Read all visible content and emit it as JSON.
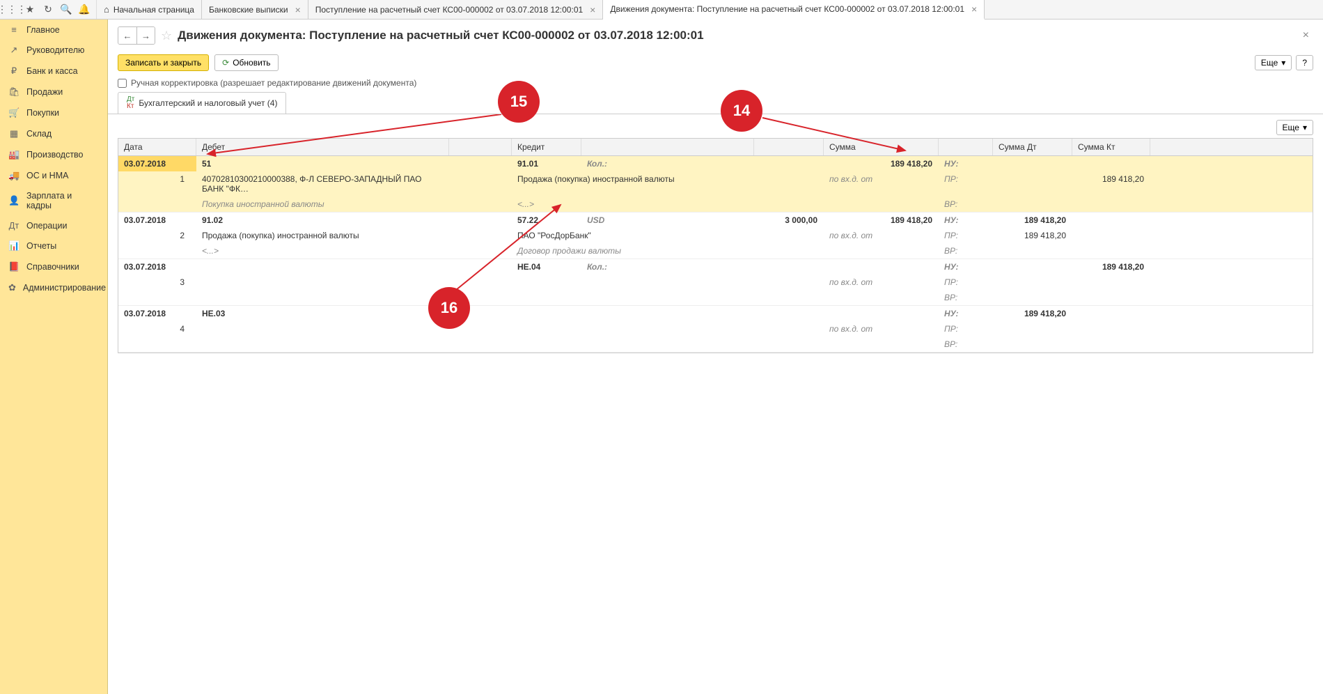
{
  "topTabs": [
    {
      "label": "Начальная страница",
      "home": true,
      "close": false
    },
    {
      "label": "Банковские выписки",
      "close": true
    },
    {
      "label": "Поступление на расчетный счет КС00-000002 от 03.07.2018 12:00:01",
      "close": true
    },
    {
      "label": "Движения документа: Поступление на расчетный счет КС00-000002 от 03.07.2018 12:00:01",
      "close": true,
      "active": true
    }
  ],
  "sidebar": [
    {
      "icon": "≡",
      "label": "Главное"
    },
    {
      "icon": "↗",
      "label": "Руководителю"
    },
    {
      "icon": "₽",
      "label": "Банк и касса"
    },
    {
      "icon": "🛍",
      "label": "Продажи"
    },
    {
      "icon": "🛒",
      "label": "Покупки"
    },
    {
      "icon": "▦",
      "label": "Склад"
    },
    {
      "icon": "🏭",
      "label": "Производство"
    },
    {
      "icon": "🚚",
      "label": "ОС и НМА"
    },
    {
      "icon": "👤",
      "label": "Зарплата и кадры"
    },
    {
      "icon": "Дт",
      "label": "Операции"
    },
    {
      "icon": "📊",
      "label": "Отчеты"
    },
    {
      "icon": "📕",
      "label": "Справочники"
    },
    {
      "icon": "✿",
      "label": "Администрирование"
    }
  ],
  "pageTitle": "Движения документа: Поступление на расчетный счет КС00-000002 от 03.07.2018 12:00:01",
  "buttons": {
    "save": "Записать и закрыть",
    "refresh": "Обновить",
    "more": "Еще",
    "help": "?"
  },
  "checkboxLabel": "Ручная корректировка (разрешает редактирование движений документа)",
  "docTab": "Бухгалтерский и налоговый учет (4)",
  "cols": {
    "date": "Дата",
    "debit": "Дебет",
    "credit": "Кредит",
    "sum": "Сумма",
    "sdt": "Сумма Дт",
    "skt": "Сумма Кт"
  },
  "labels": {
    "nu": "НУ:",
    "pr": "ПР:",
    "vr": "ВР:",
    "kol": "Кол.:",
    "vhd": "по вх.д.  от"
  },
  "rows": [
    {
      "date": "03.07.2018",
      "num": "1",
      "d_acc": "51",
      "d_sub1": "40702810300210000388, Ф-Л СЕВЕРО-ЗАПАДНЫЙ ПАО БАНК \"ФК…",
      "d_sub2": "Покупка иностранной валюты",
      "c_acc": "91.01",
      "c_sub1": "Продажа (покупка) иностранной валюты",
      "c_sub2": "<...>",
      "c_kol": "",
      "c_qty": "",
      "sum": "189 418,20",
      "skt_pr": "189 418,20",
      "selected": true
    },
    {
      "date": "03.07.2018",
      "num": "2",
      "d_acc": "91.02",
      "d_sub1": "Продажа (покупка) иностранной валюты",
      "d_sub2": "<...>",
      "c_acc": "57.22",
      "c_sub1": "ПАО \"РосДорБанк\"",
      "c_sub2": "Договор продажи валюты",
      "c_cur": "USD",
      "c_qty": "3 000,00",
      "sum": "189 418,20",
      "sdt_nu": "189 418,20",
      "sdt_pr": "189 418,20"
    },
    {
      "date": "03.07.2018",
      "num": "3",
      "d_acc": "",
      "d_sub1": "",
      "d_sub2": "",
      "c_acc": "НЕ.04",
      "c_sub1": "",
      "c_sub2": "",
      "sum": "",
      "skt_nu": "189 418,20"
    },
    {
      "date": "03.07.2018",
      "num": "4",
      "d_acc": "НЕ.03",
      "d_sub1": "",
      "d_sub2": "",
      "c_acc": "",
      "c_sub1": "",
      "c_sub2": "",
      "sum": "",
      "sdt_nu": "189 418,20"
    }
  ],
  "annotations": {
    "a14": "14",
    "a15": "15",
    "a16": "16"
  }
}
